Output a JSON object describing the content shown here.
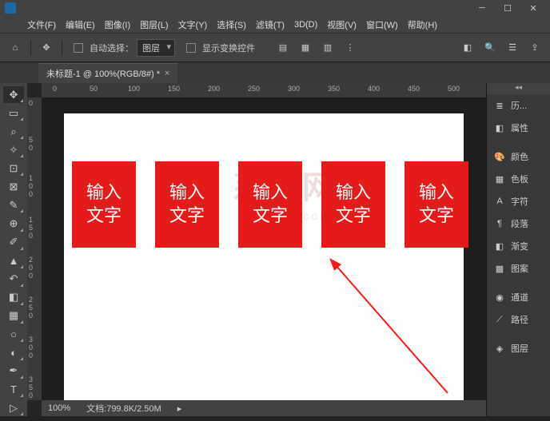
{
  "menu": {
    "file": "文件(F)",
    "edit": "编辑(E)",
    "image": "图像(I)",
    "layer": "图层(L)",
    "text": "文字(Y)",
    "select": "选择(S)",
    "filter": "滤镜(T)",
    "threeD": "3D(D)",
    "view": "视图(V)",
    "window": "窗口(W)",
    "help": "帮助(H)"
  },
  "options": {
    "autoSelect": "自动选择：",
    "layerSel": "图层",
    "showTransform": "显示变换控件"
  },
  "docTab": {
    "title": "未标题-1 @ 100%(RGB/8#) *"
  },
  "rulerH": {
    "m0": "0",
    "m50": "50",
    "m100": "100",
    "m150": "150",
    "m200": "200",
    "m250": "250",
    "m300": "300",
    "m350": "350",
    "m400": "400",
    "m450": "450",
    "m500": "500"
  },
  "rulerV": {
    "m0": "0",
    "m50": "5\n0",
    "m100": "1\n0\n0",
    "m150": "1\n5\n0",
    "m200": "2\n0\n0",
    "m250": "2\n5\n0",
    "m300": "3\n0\n0",
    "m350": "3\n5\n0"
  },
  "box": {
    "line1": "输入",
    "line2": "文字"
  },
  "status": {
    "zoom": "100%",
    "doc": "文档:799.8K/2.50M"
  },
  "panels": {
    "history": "历...",
    "properties": "属性",
    "color": "颜色",
    "swatches": "色板",
    "character": "字符",
    "paragraph": "段落",
    "gradient": "渐变",
    "patterns": "图案",
    "channels": "通道",
    "paths": "路径",
    "layers": "图层"
  },
  "watermark": {
    "a": "系统网",
    "b": "system.com"
  }
}
